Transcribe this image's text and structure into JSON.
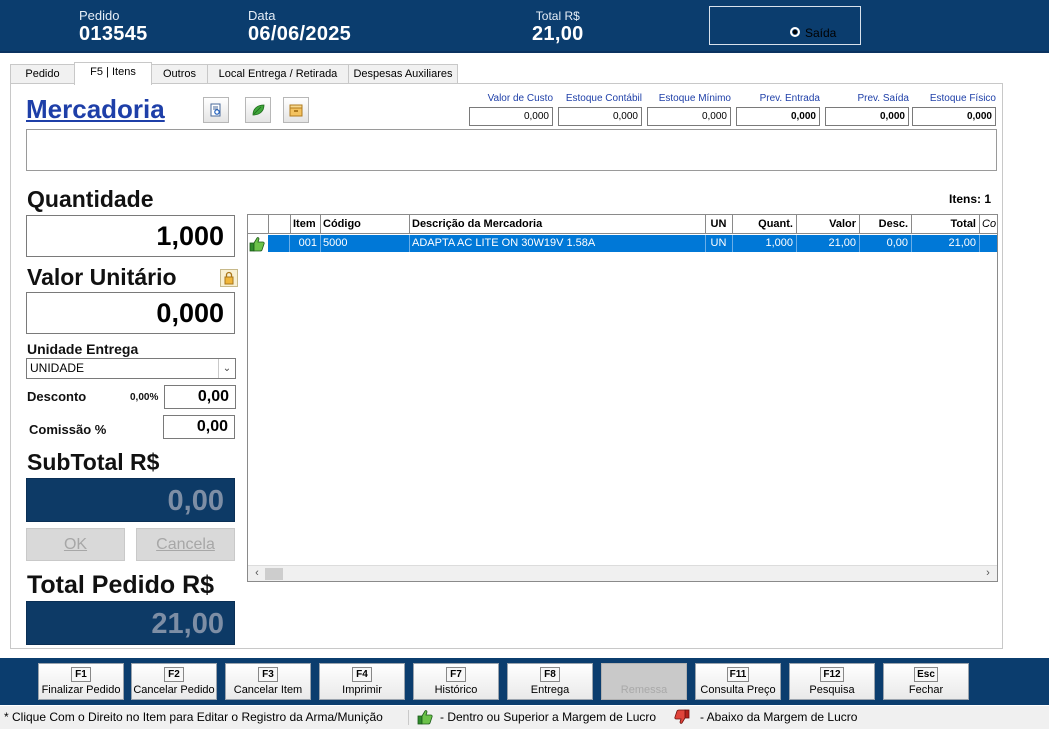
{
  "header": {
    "pedido_label": "Pedido",
    "pedido_value": "013545",
    "data_label": "Data",
    "data_value": "06/06/2025",
    "total_label": "Total R$",
    "total_value": "21,00",
    "saida_label": "Saída"
  },
  "tabs": [
    {
      "label": "Pedido",
      "active": false
    },
    {
      "label": "F5 | Itens",
      "active": true
    },
    {
      "label": "Outros",
      "active": false
    },
    {
      "label": "Local Entrega  / Retirada",
      "active": false
    },
    {
      "label": "Despesas Auxiliares",
      "active": false
    }
  ],
  "mercadoria": {
    "title": "Mercadoria",
    "tool_icons": [
      "document-search-icon",
      "leaf-icon",
      "box-icon"
    ],
    "description": ""
  },
  "stock": [
    {
      "label": "Valor de Custo",
      "value": "0,000"
    },
    {
      "label": "Estoque Contábil",
      "value": "0,000"
    },
    {
      "label": "Estoque Mínimo",
      "value": "0,000"
    },
    {
      "label": "Prev. Entrada",
      "value": "0,000"
    },
    {
      "label": "Prev. Saída",
      "value": "0,000"
    },
    {
      "label": "Estoque Físico",
      "value": "0,000"
    }
  ],
  "form": {
    "quantidade_label": "Quantidade",
    "quantidade_value": "1,000",
    "valor_unitario_label": "Valor Unitário",
    "valor_unitario_value": "0,000",
    "unidade_entrega_label": "Unidade Entrega",
    "unidade_entrega_value": "UNIDADE",
    "desconto_label": "Desconto",
    "desconto_percent": "0,00%",
    "desconto_value": "0,00",
    "comissao_label": "Comissão %",
    "comissao_value": "0,00",
    "subtotal_label": "SubTotal R$",
    "subtotal_value": "0,00",
    "ok_label": "OK",
    "cancela_label": "Cancela",
    "total_pedido_label": "Total Pedido R$",
    "total_pedido_value": "21,00"
  },
  "grid": {
    "itens_count": "Itens: 1",
    "columns": [
      "Item",
      "Código",
      "Descrição da Mercadoria",
      "UN",
      "Quant.",
      "Valor",
      "Desc.",
      "Total",
      "Co"
    ],
    "rows": [
      {
        "item": "001",
        "codigo": "5000",
        "descricao": "ADAPTA AC LITE ON 30W19V 1.58A",
        "un": "UN",
        "quant": "1,000",
        "valor": "21,00",
        "desc": "0,00",
        "total": "21,00",
        "co": ""
      }
    ]
  },
  "function_keys": [
    {
      "key": "F1",
      "label": "Finalizar Pedido",
      "enabled": true
    },
    {
      "key": "F2",
      "label": "Cancelar Pedido",
      "enabled": true
    },
    {
      "key": "F3",
      "label": "Cancelar Item",
      "enabled": true
    },
    {
      "key": "F4",
      "label": "Imprimir",
      "enabled": true
    },
    {
      "key": "F7",
      "label": "Histórico",
      "enabled": true
    },
    {
      "key": "F8",
      "label": "Entrega",
      "enabled": true
    },
    {
      "key": "",
      "label": "Remessa",
      "enabled": false
    },
    {
      "key": "F11",
      "label": "Consulta Preço",
      "enabled": true
    },
    {
      "key": "F12",
      "label": "Pesquisa",
      "enabled": true
    },
    {
      "key": "Esc",
      "label": "Fechar",
      "enabled": true
    }
  ],
  "status": {
    "hint": "* Clique Com o Direito no Item para Editar o Registro da Arma/Munição",
    "legend_up": "- Dentro ou Superior a Margem de Lucro",
    "legend_down": "- Abaixo da Margem de Lucro"
  },
  "colors": {
    "header_bg": "#0b3d6e",
    "selected_row": "#0078d7",
    "link_blue": "#1e3fa8"
  }
}
